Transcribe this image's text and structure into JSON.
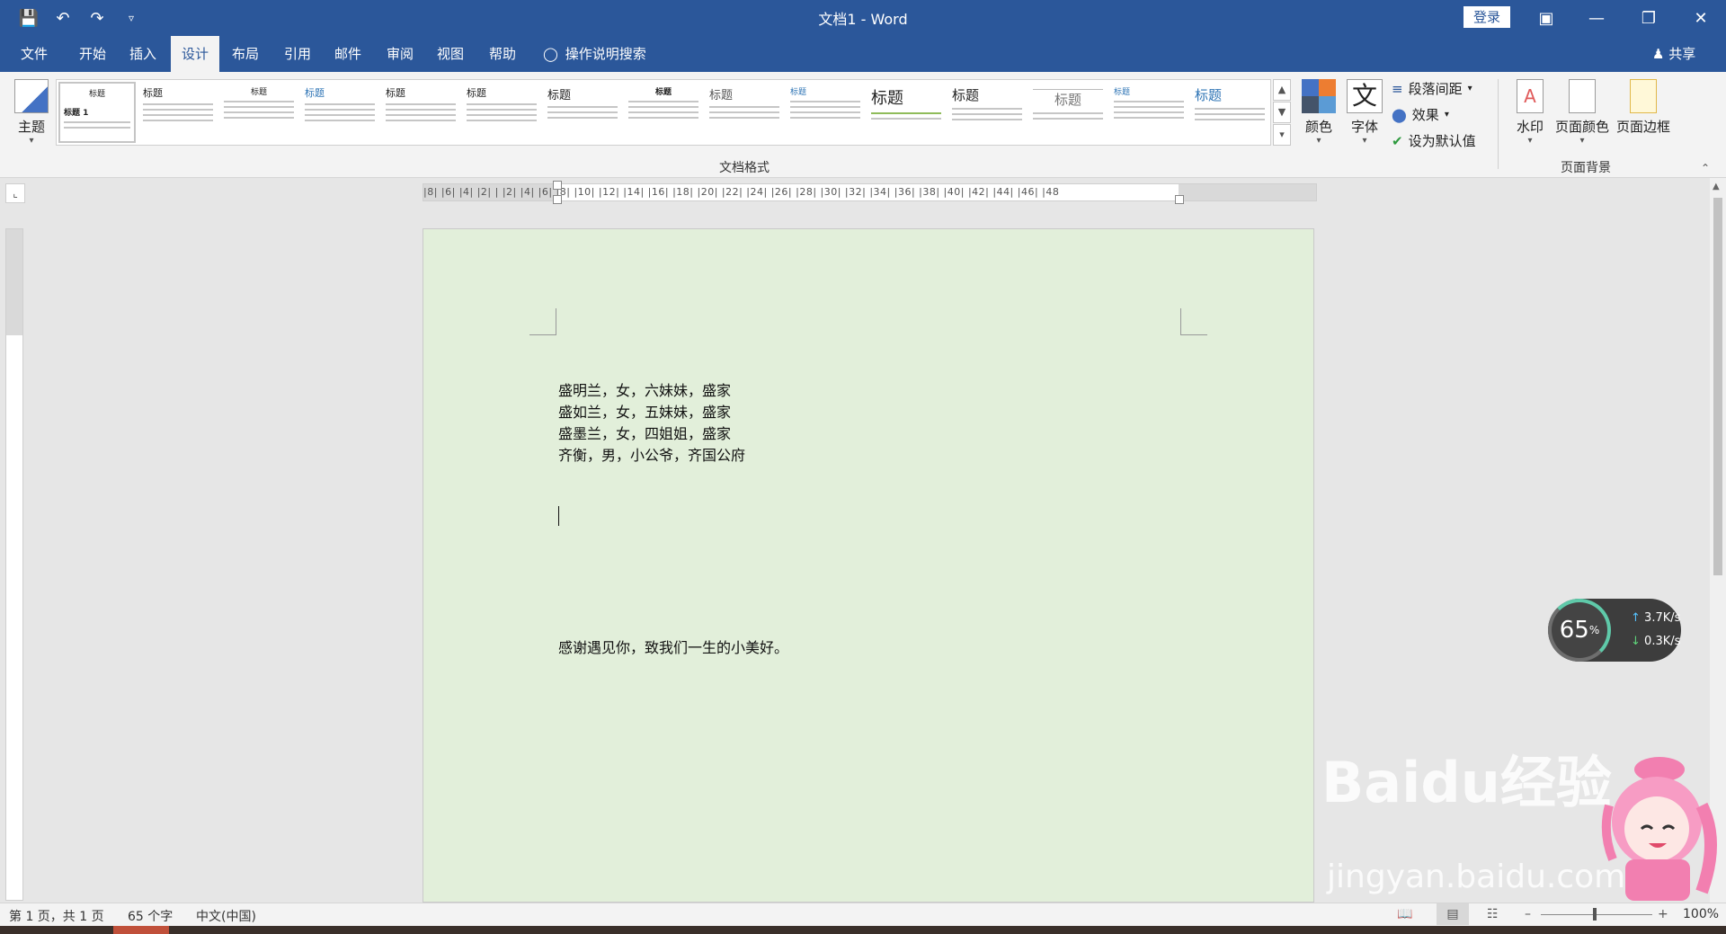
{
  "window": {
    "title": "文档1 - Word",
    "login_label": "登录"
  },
  "menu": {
    "tabs": [
      "文件",
      "开始",
      "插入",
      "设计",
      "布局",
      "引用",
      "邮件",
      "审阅",
      "视图",
      "帮助"
    ],
    "active": "设计",
    "search_hint": "操作说明搜索",
    "share": "共享"
  },
  "ribbon": {
    "theme_label": "主题",
    "gallery_items": [
      "标题",
      "标题",
      "标题",
      "标题",
      "标题",
      "标题",
      "标题",
      "标题",
      "标题",
      "标题",
      "标题",
      "标题",
      "标题",
      "标题",
      "标题"
    ],
    "group_doc_format": "文档格式",
    "colors_label": "颜色",
    "fonts_label": "字体",
    "font_icon_char": "文",
    "paragraph_spacing": "段落间距",
    "effects": "效果",
    "set_default": "设为默认值",
    "watermark_label": "水印",
    "page_color_label": "页面颜色",
    "page_border_label": "页面边框",
    "group_page_bg": "页面背景",
    "page_color_hex": "#e2efda"
  },
  "ruler": {
    "text": "|8|  |6|  |4|  |2|  |  |2|  |4|  |6|  |8|  |10|  |12|  |14|  |16|  |18|  |20|  |22|  |24|  |26|  |28|  |30|  |32|  |34|  |36|  |38|  |40|  |42|  |44|  |46|  |48"
  },
  "document": {
    "lines": [
      "盛明兰，女，六妹妹，盛家",
      "盛如兰，女，五妹妹，盛家",
      "盛墨兰，女，四姐姐，盛家",
      "齐衡，男，小公爷，齐国公府"
    ],
    "closing": "感谢遇见你，致我们一生的小美好。"
  },
  "status": {
    "page": "第 1 页，共 1 页",
    "words": "65 个字",
    "language": "中文(中国)",
    "zoom": "100%"
  },
  "net_widget": {
    "percent": "65",
    "percent_unit": "%",
    "up": "3.7K/s",
    "down": "0.3K/s"
  },
  "watermark": {
    "line1": "Baidu经验",
    "line2": "jingyan.baidu.com"
  }
}
